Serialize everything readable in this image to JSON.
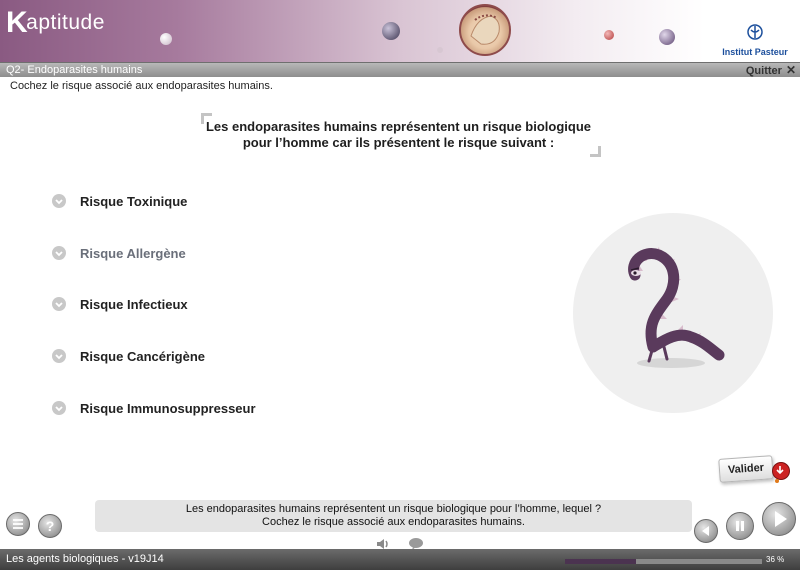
{
  "header": {
    "logo_text": "aptitude",
    "logo_k": "K",
    "partner": "Institut Pasteur"
  },
  "titlebar": {
    "question_id": "Q2- Endoparasites humains",
    "quit_label": "Quitter",
    "quit_symbol": "✕"
  },
  "instruction": "Cochez le risque associé aux endoparasites humains.",
  "statement": {
    "line1": "Les endoparasites humains représentent un risque biologique",
    "line2": "pour l’homme car ils présentent le risque suivant :"
  },
  "options": [
    {
      "label": "Risque Toxinique",
      "dimmed": false
    },
    {
      "label": "Risque Allergène",
      "dimmed": true
    },
    {
      "label": "Risque Infectieux",
      "dimmed": false
    },
    {
      "label": "Risque Cancérigène",
      "dimmed": false
    },
    {
      "label": "Risque Immunosuppresseur",
      "dimmed": false
    }
  ],
  "validate_label": "Valider",
  "tip": {
    "line1": "Les endoparasites humains représentent un risque biologique pour l’homme, lequel ?",
    "line2": "Cochez le risque associé aux endoparasites humains."
  },
  "footer": {
    "course_title": "Les agents biologiques - v19J14",
    "progress_text": "36 %",
    "progress_value": 0.36
  },
  "colors": {
    "accent": "#8a5a82",
    "progress": "#4b3350",
    "creature": "#5a3a5c"
  }
}
